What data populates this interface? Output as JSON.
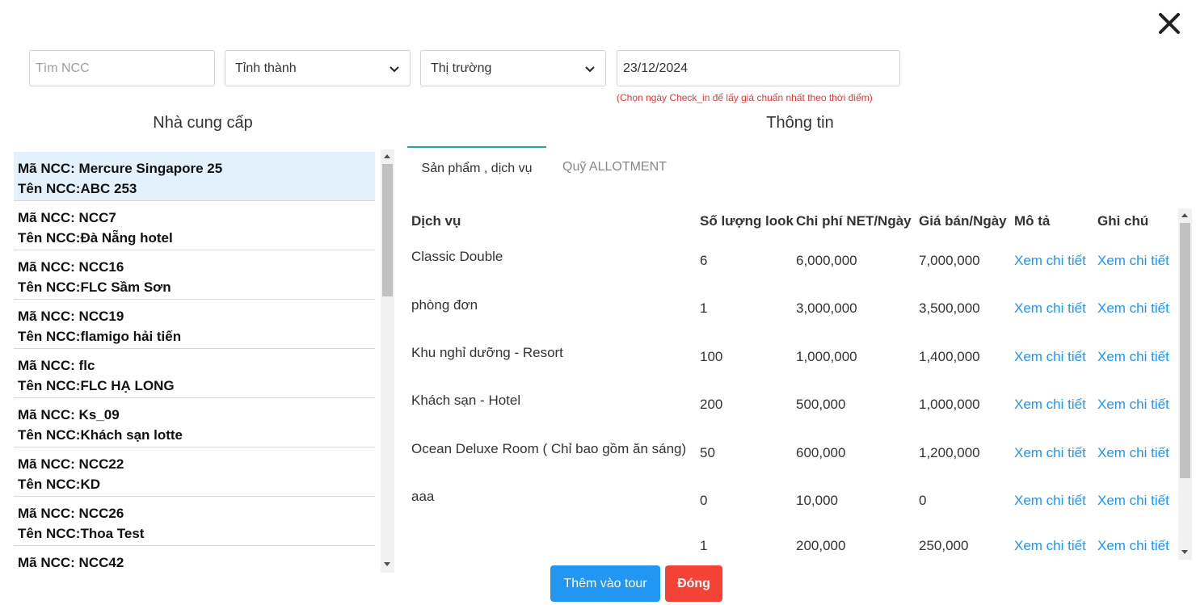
{
  "filters": {
    "search_placeholder": "Tìm NCC",
    "province_selected": "Tỉnh thành",
    "market_selected": "Thị trường",
    "date_value": "23/12/2024",
    "date_hint": "(Chọn ngày Check_in để lấy giá chuẩn nhất theo thời điểm)"
  },
  "suppliers": {
    "title": "Nhà cung cấp",
    "items": [
      {
        "code": "Mã NCC: Mercure Singapore 25",
        "name": "Tên NCC:ABC 253"
      },
      {
        "code": "Mã NCC: NCC7",
        "name": "Tên NCC:Đà Nẵng hotel"
      },
      {
        "code": "Mã NCC: NCC16",
        "name": "Tên NCC:FLC Sầm Sơn"
      },
      {
        "code": "Mã NCC: NCC19",
        "name": "Tên NCC:flamigo hải tiến"
      },
      {
        "code": "Mã NCC: flc",
        "name": "Tên NCC:FLC HẠ LONG"
      },
      {
        "code": "Mã NCC: Ks_09",
        "name": "Tên NCC:Khách sạn lotte"
      },
      {
        "code": "Mã NCC: NCC22",
        "name": "Tên NCC:KD"
      },
      {
        "code": "Mã NCC: NCC26",
        "name": "Tên NCC:Thoa Test"
      },
      {
        "code": "Mã NCC: NCC42",
        "name": ""
      }
    ]
  },
  "info": {
    "title": "Thông tin",
    "tabs": [
      "Sản phẩm , dịch vụ",
      "Quỹ ALLOTMENT"
    ],
    "columns": [
      "Dịch vụ",
      "Số lượng look",
      "Chi phí NET/Ngày",
      "Giá bán/Ngày",
      "Mô tả",
      "Ghi chú"
    ],
    "rows": [
      {
        "service": "Classic Double",
        "qty": "6",
        "net": "6,000,000",
        "price": "7,000,000",
        "desc": "Xem chi tiết",
        "note": "Xem chi tiết"
      },
      {
        "service": "phòng đơn",
        "qty": "1",
        "net": "3,000,000",
        "price": "3,500,000",
        "desc": "Xem chi tiết",
        "note": "Xem chi tiết"
      },
      {
        "service": "Khu nghỉ dưỡng - Resort",
        "qty": "100",
        "net": "1,000,000",
        "price": "1,400,000",
        "desc": "Xem chi tiết",
        "note": "Xem chi tiết"
      },
      {
        "service": "Khách sạn - Hotel",
        "qty": "200",
        "net": "500,000",
        "price": "1,000,000",
        "desc": "Xem chi tiết",
        "note": "Xem chi tiết"
      },
      {
        "service": "Ocean Deluxe Room ( Chỉ bao gồm ăn sáng)",
        "qty": "50",
        "net": "600,000",
        "price": "1,200,000",
        "desc": "Xem chi tiết",
        "note": "Xem chi tiết"
      },
      {
        "service": "aaa",
        "qty": "0",
        "net": "10,000",
        "price": "0",
        "desc": "Xem chi tiết",
        "note": "Xem chi tiết"
      },
      {
        "service": "",
        "qty": "1",
        "net": "200,000",
        "price": "250,000",
        "desc": "Xem chi tiết",
        "note": "Xem chi tiết"
      }
    ]
  },
  "actions": {
    "add_label": "Thêm vào tour",
    "close_label": "Đóng"
  },
  "icons": {
    "close": "close-icon",
    "chevron": "chevron-down-icon"
  }
}
